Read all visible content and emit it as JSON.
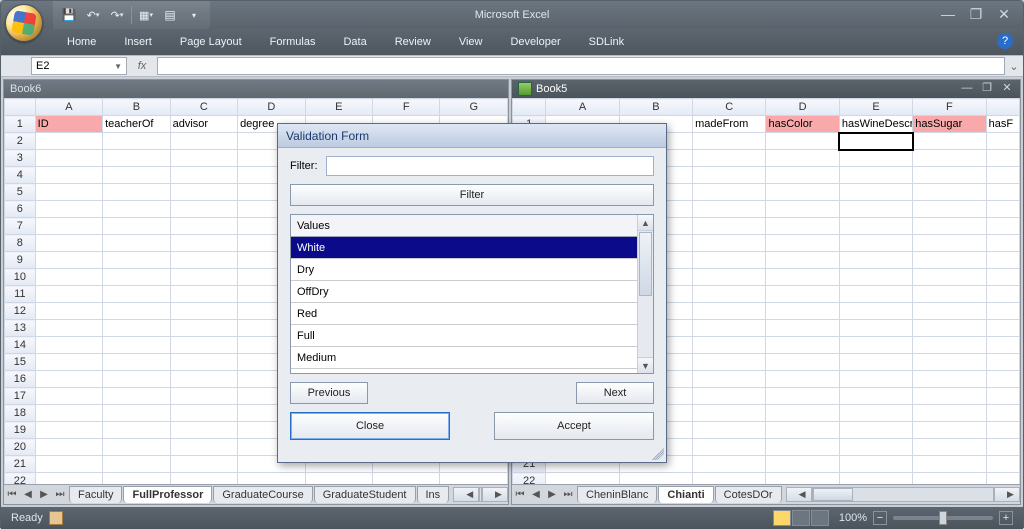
{
  "app_title": "Microsoft Excel",
  "qat": {
    "save": "💾",
    "undo": "↶",
    "redo": "↷",
    "custom1": "▦",
    "custom2": "▤"
  },
  "ribbon_tabs": [
    "Home",
    "Insert",
    "Page Layout",
    "Formulas",
    "Data",
    "Review",
    "View",
    "Developer",
    "SDLink"
  ],
  "name_box": "E2",
  "formula": "",
  "workbooks": {
    "left": {
      "title": "Book6",
      "columns": [
        "A",
        "B",
        "C",
        "D",
        "E",
        "F",
        "G"
      ],
      "headers": [
        "ID",
        "teacherOf",
        "advisor",
        "degree",
        "",
        "",
        ""
      ],
      "highlight_cols": [
        0
      ],
      "rows": 22,
      "tabs": [
        "Faculty",
        "FullProfessor",
        "GraduateCourse",
        "GraduateStudent",
        "Ins"
      ],
      "active_tab": 1
    },
    "right": {
      "title": "Book5",
      "columns": [
        "A",
        "B",
        "C",
        "D",
        "E",
        "F"
      ],
      "headers": [
        "",
        "",
        "madeFrom",
        "hasColor",
        "hasWineDescriptor",
        "hasSugar"
      ],
      "highlight_cols": [
        3,
        5
      ],
      "partialF": "hasF",
      "selected_cell": [
        0,
        4
      ],
      "rows": 1,
      "tabs": [
        "CheninBlanc",
        "Chianti",
        "CotesDOr"
      ],
      "active_tab": 1
    }
  },
  "dialog": {
    "title": "Validation Form",
    "filter_label": "Filter:",
    "filter_value": "",
    "filter_button": "Filter",
    "list_header": "Values",
    "items": [
      "White",
      "Dry",
      "OffDry",
      "Red",
      "Full",
      "Medium"
    ],
    "selected_index": 0,
    "prev": "Previous",
    "next": "Next",
    "close": "Close",
    "accept": "Accept"
  },
  "status": {
    "ready": "Ready",
    "zoom": "100%"
  },
  "window_controls": {
    "min": "—",
    "max": "❐",
    "close": "✕"
  }
}
